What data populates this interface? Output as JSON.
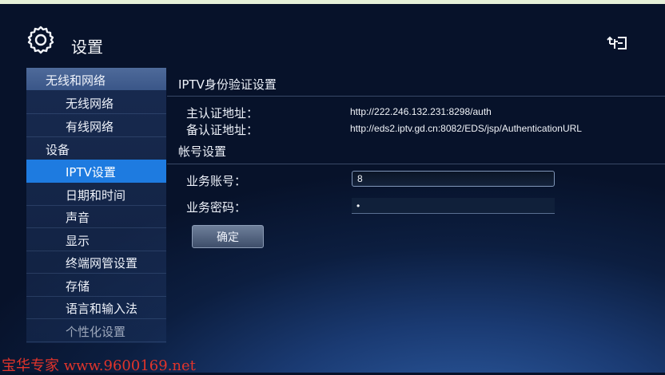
{
  "header": {
    "title": "设置",
    "settings_icon": "gear-icon",
    "usb_icon": "usb-icon"
  },
  "sidebar": {
    "groups": [
      {
        "label": "无线和网络"
      },
      {
        "label": "设备"
      }
    ],
    "items": [
      {
        "label": "无线网络"
      },
      {
        "label": "有线网络"
      },
      {
        "label": "IPTV设置"
      },
      {
        "label": "日期和时间"
      },
      {
        "label": "声音"
      },
      {
        "label": "显示"
      },
      {
        "label": "终端网管设置"
      },
      {
        "label": "存储"
      },
      {
        "label": "语言和输入法"
      },
      {
        "label": "个性化设置"
      }
    ],
    "active_item": "IPTV设置"
  },
  "auth": {
    "title": "IPTV身份验证设置",
    "primary_label": "主认证地址：",
    "primary_value": "http://222.246.132.231:8298/auth",
    "backup_label": "备认证地址：",
    "backup_value": "http://eds2.iptv.gd.cn:8082/EDS/jsp/AuthenticationURL"
  },
  "account": {
    "title": "帐号设置",
    "account_label": "业务账号：",
    "account_value": "8",
    "password_label": "业务密码：",
    "password_value": "•",
    "confirm_label": "确定"
  },
  "watermark": "宝华专家 www.9600169.net",
  "colors": {
    "active_item": "#1e7be0",
    "watermark": "#e0342b",
    "group_header": "#4e6a9a"
  }
}
